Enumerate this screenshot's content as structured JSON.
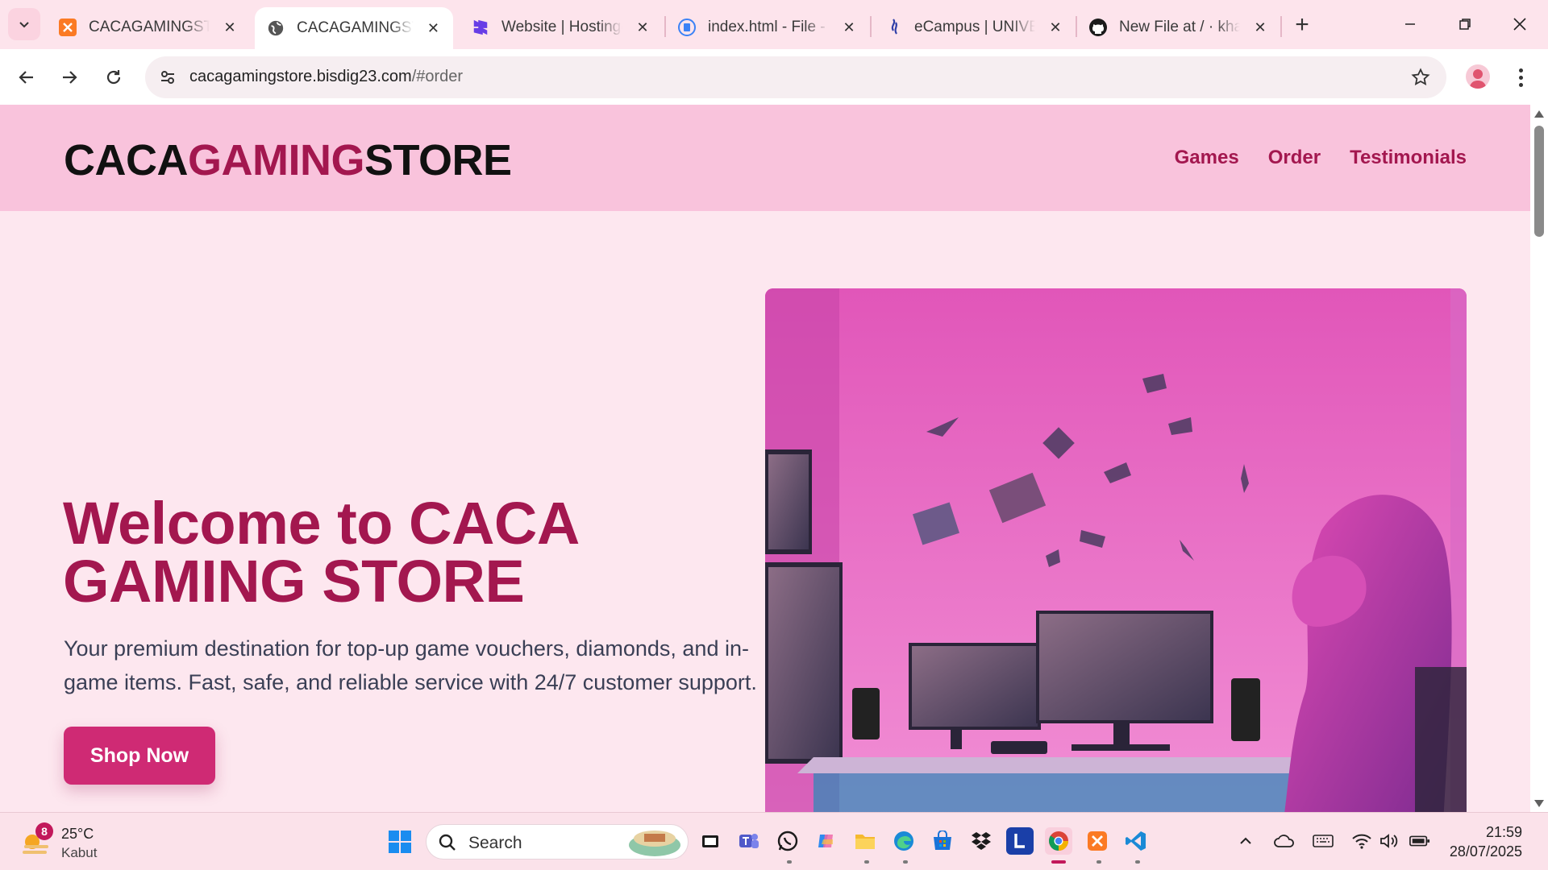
{
  "browser": {
    "tabs": [
      {
        "title": "CACAGAMINGSTORE",
        "icon": "xampp-icon",
        "active": false
      },
      {
        "title": "CACAGAMINGSTORE",
        "icon": "globe-icon",
        "active": true
      },
      {
        "title": "Website | Hostinger",
        "icon": "hostinger-icon",
        "active": false
      },
      {
        "title": "index.html - File - Hostinger",
        "icon": "file-manager-icon",
        "active": false
      },
      {
        "title": "eCampus | UNIVERSITAS",
        "icon": "ecampus-icon",
        "active": false
      },
      {
        "title": "New File at / · khansa",
        "icon": "github-icon",
        "active": false
      }
    ],
    "address": {
      "host": "cacagamingstore.bisdig23.com",
      "path": "/#order"
    }
  },
  "site": {
    "logo": {
      "part1": "CACA",
      "part2": "GAMING",
      "part3": "STORE"
    },
    "nav": [
      "Games",
      "Order",
      "Testimonials"
    ],
    "hero": {
      "title_line1": "Welcome to CACA",
      "title_line2": "GAMING STORE",
      "description": "Your premium destination for top-up game vouchers, diamonds, and in-game items. Fast, safe, and reliable service with 24/7 customer support.",
      "cta": "Shop Now"
    },
    "colors": {
      "brand": "#a3174f",
      "header_bg": "#f9c3dc",
      "page_bg": "#fde7ef",
      "button": "#cf2a74"
    }
  },
  "taskbar": {
    "weather": {
      "badge": "8",
      "temp": "25°C",
      "condition": "Kabut"
    },
    "search_placeholder": "Search",
    "clock": {
      "time": "21:59",
      "date": "28/07/2025"
    }
  }
}
